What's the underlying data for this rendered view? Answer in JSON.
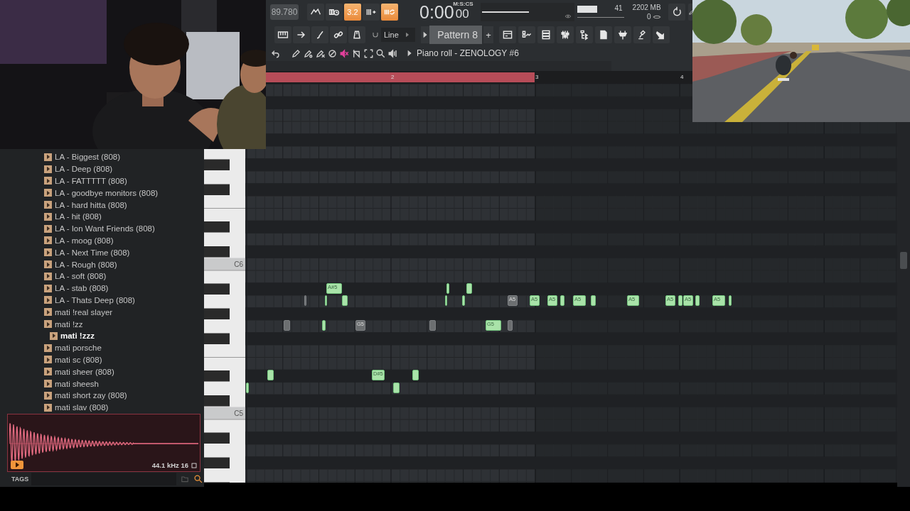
{
  "toolbar": {
    "tempo": "89.780",
    "toggles": [
      {
        "kind": "blend",
        "on": false
      },
      {
        "kind": "wait",
        "on": false
      },
      {
        "kind": "countdown",
        "label": "3.2",
        "on": true
      },
      {
        "kind": "step",
        "on": false
      },
      {
        "kind": "loop",
        "on": true
      }
    ],
    "time": {
      "main": "0:00",
      "sub": "00",
      "format": "M:S:CS"
    },
    "cpu": "41",
    "memory": "2202 MB",
    "polyphony": "0",
    "snap": "Line",
    "pattern": "Pattern 8",
    "add": "+",
    "window_title": "Piano roll - ZENOLOGY #6"
  },
  "timeline": {
    "markers": [
      "2",
      "3",
      "4"
    ]
  },
  "browser": {
    "items": [
      {
        "label": "LA - Biggest (808)",
        "selected": false
      },
      {
        "label": "LA - Deep (808)",
        "selected": false
      },
      {
        "label": "LA - FATTTTT (808)",
        "selected": false
      },
      {
        "label": "LA - goodbye monitors (808)",
        "selected": false
      },
      {
        "label": "LA - hard hitta (808)",
        "selected": false
      },
      {
        "label": "LA - hit (808)",
        "selected": false
      },
      {
        "label": "LA - Ion Want Friends (808)",
        "selected": false
      },
      {
        "label": "LA - moog (808)",
        "selected": false
      },
      {
        "label": "LA - Next Time (808)",
        "selected": false
      },
      {
        "label": "LA - Rough (808)",
        "selected": false
      },
      {
        "label": "LA - soft (808)",
        "selected": false
      },
      {
        "label": "LA - stab (808)",
        "selected": false
      },
      {
        "label": "LA - Thats Deep (808)",
        "selected": false
      },
      {
        "label": "mati !real slayer",
        "selected": false
      },
      {
        "label": "mati !zz",
        "selected": false,
        "children": [
          {
            "label": "mati !zzz",
            "selected": true
          }
        ]
      },
      {
        "label": "mati porsche",
        "selected": false
      },
      {
        "label": "mati sc (808)",
        "selected": false
      },
      {
        "label": "mati sheer (808)",
        "selected": false
      },
      {
        "label": "mati sheesh",
        "selected": false
      },
      {
        "label": "mati short zay (808)",
        "selected": false
      },
      {
        "label": "mati slav (808)",
        "selected": false
      }
    ],
    "sample_info": "44.1 kHz 16",
    "tags": "TAGS"
  },
  "piano": {
    "labels": [
      "C6",
      "C5"
    ]
  },
  "notes": [
    {
      "label": "A#5",
      "ghost": false
    },
    {
      "ghost": false
    },
    {
      "ghost": false
    },
    {
      "ghost": true
    },
    {
      "ghost": false
    },
    {
      "ghost": false
    },
    {
      "ghost": false
    },
    {
      "ghost": false
    },
    {
      "label": "A5",
      "ghost": true
    },
    {
      "label": "A5",
      "ghost": false
    },
    {
      "label": "A5",
      "ghost": false
    },
    {
      "ghost": false
    },
    {
      "label": "A5",
      "ghost": false
    },
    {
      "ghost": false
    },
    {
      "label": "A5",
      "ghost": false
    },
    {
      "label": "A5",
      "ghost": false
    },
    {
      "ghost": false
    },
    {
      "label": "A5",
      "ghost": false
    },
    {
      "ghost": false
    },
    {
      "label": "A5",
      "ghost": false
    },
    {
      "ghost": false
    },
    {
      "ghost": true
    },
    {
      "ghost": false
    },
    {
      "label": "G5",
      "ghost": true
    },
    {
      "ghost": true
    },
    {
      "label": "G5",
      "ghost": false
    },
    {
      "ghost": true
    },
    {
      "ghost": false
    },
    {
      "label": "D#5",
      "ghost": false
    },
    {
      "ghost": false
    },
    {
      "ghost": false
    },
    {
      "ghost": false
    }
  ]
}
